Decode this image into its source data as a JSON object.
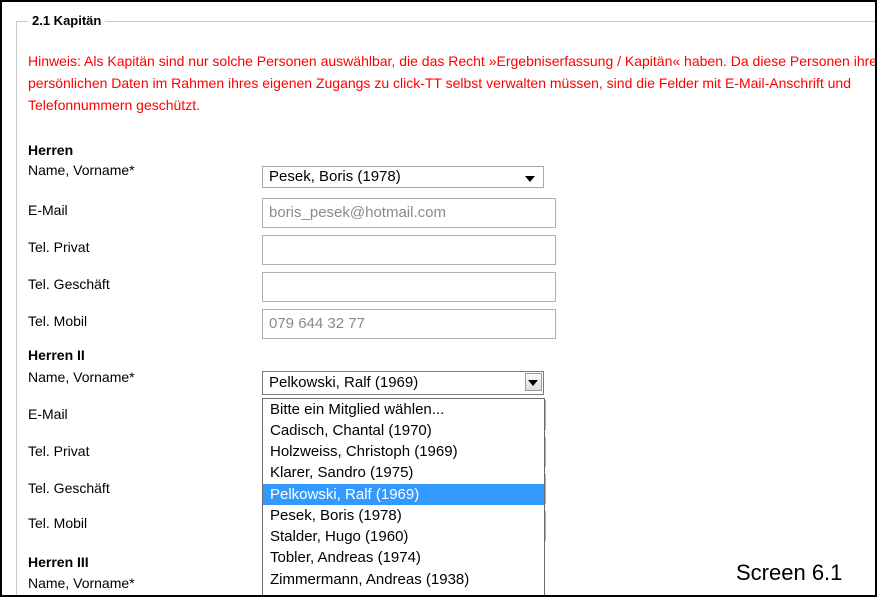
{
  "section": {
    "legend": "2.1 Kapitän",
    "hint": "Hinweis: Als Kapitän sind nur solche Personen auswählbar, die das Recht »Ergebniserfassung / Kapitän« haben. Da diese Personen ihre persönlichen Daten im Rahmen ihres eigenen Zugangs zu click-TT selbst verwalten müssen, sind die Felder mit E-Mail-Anschrift und Telefonnummern geschützt."
  },
  "labels": {
    "name": "Name, Vorname*",
    "email": "E-Mail",
    "tel_privat": "Tel. Privat",
    "tel_geschaeft": "Tel. Geschäft",
    "tel_mobil": "Tel. Mobil"
  },
  "herren": {
    "title": "Herren",
    "selected": "Pesek, Boris (1978)",
    "email": "boris_pesek@hotmail.com",
    "tel_privat": "",
    "tel_geschaeft": "",
    "tel_mobil": "079 644 32 77"
  },
  "herren2": {
    "title": "Herren II",
    "selected": "Pelkowski, Ralf (1969)"
  },
  "herren3": {
    "title": "Herren III"
  },
  "dropdown": {
    "options": [
      "Bitte ein Mitglied wählen...",
      "Cadisch, Chantal (1970)",
      "Holzweiss, Christoph (1969)",
      "Klarer, Sandro (1975)",
      "Pelkowski, Ralf (1969)",
      "Pesek, Boris (1978)",
      "Stalder, Hugo (1960)",
      "Tobler, Andreas (1974)",
      "Zimmermann, Andreas (1938)"
    ],
    "selected_index": 4
  },
  "caption": "Screen 6.1",
  "colors": {
    "hint": "#ff0000",
    "selection": "#3399ff"
  }
}
